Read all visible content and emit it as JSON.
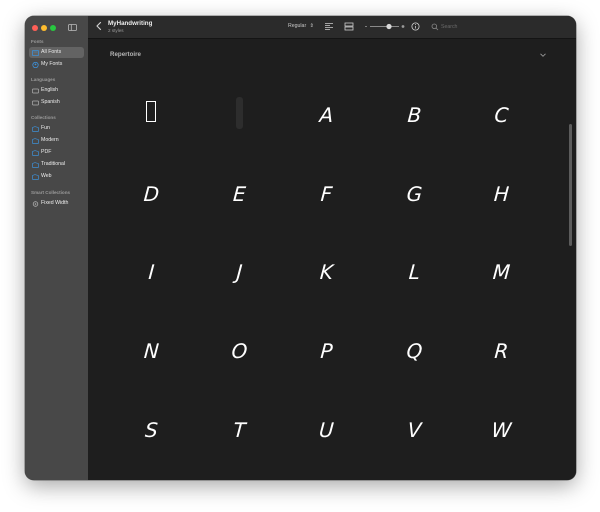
{
  "sidebar": {
    "sections": [
      {
        "title": "Fonts",
        "items": [
          {
            "label": "All Fonts",
            "icon": "fonts-library-icon",
            "selected": true
          },
          {
            "label": "My Fonts",
            "icon": "user-fonts-icon",
            "selected": false
          }
        ]
      },
      {
        "title": "Languages",
        "items": [
          {
            "label": "English",
            "icon": "keyboard-icon",
            "selected": false
          },
          {
            "label": "Spanish",
            "icon": "keyboard-icon",
            "selected": false
          }
        ]
      },
      {
        "title": "Collections",
        "items": [
          {
            "label": "Fun",
            "icon": "collection-icon",
            "selected": false
          },
          {
            "label": "Modern",
            "icon": "collection-icon",
            "selected": false
          },
          {
            "label": "PDF",
            "icon": "collection-icon",
            "selected": false
          },
          {
            "label": "Traditional",
            "icon": "collection-icon",
            "selected": false
          },
          {
            "label": "Web",
            "icon": "collection-icon",
            "selected": false
          }
        ]
      },
      {
        "title": "Smart Collections",
        "items": [
          {
            "label": "Fixed Width",
            "icon": "gear-icon",
            "selected": false
          }
        ]
      }
    ]
  },
  "toolbar": {
    "title": "MyHandwriting",
    "subtitle": "2 styles",
    "style_value": "Regular",
    "search_placeholder": "Search"
  },
  "content": {
    "section_title": "Repertoire",
    "glyphs": [
      "",
      "",
      "A",
      "B",
      "C",
      "D",
      "E",
      "F",
      "G",
      "H",
      "I",
      "J",
      "K",
      "L",
      "M",
      "N",
      "O",
      "P",
      "Q",
      "R",
      "S",
      "T",
      "U",
      "V",
      "W"
    ]
  },
  "colors": {
    "window_bg": "#1e1e1e",
    "sidebar_bg": "#484848",
    "selection": "#636363",
    "accent": "#3d8fd6"
  }
}
